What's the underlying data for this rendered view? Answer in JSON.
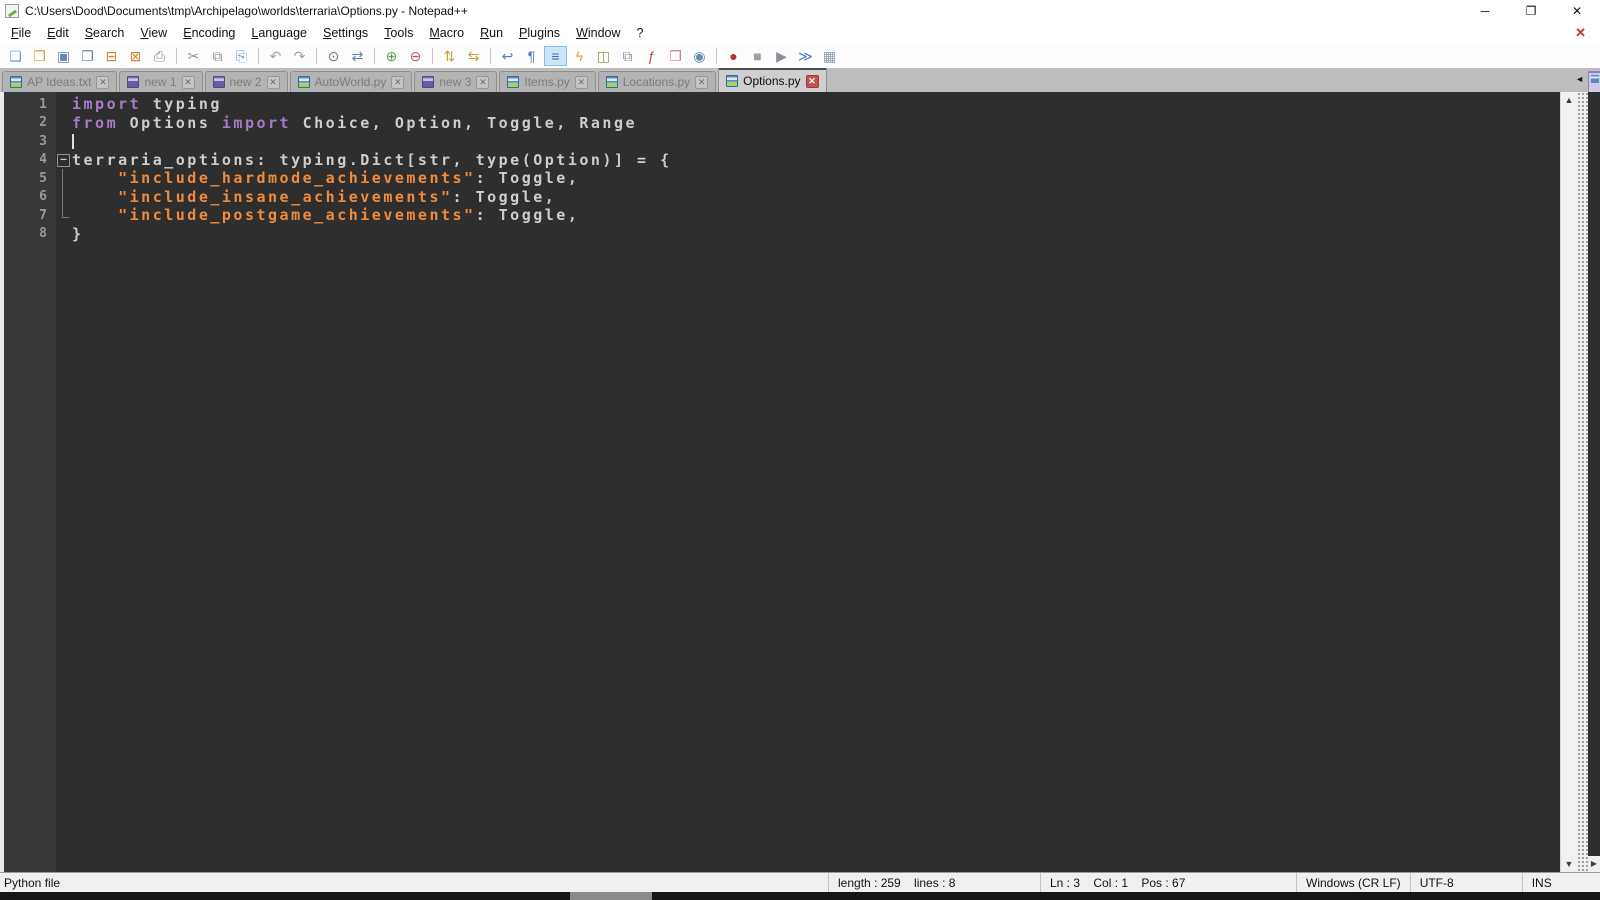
{
  "window": {
    "title": "C:\\Users\\Dood\\Documents\\tmp\\Archipelago\\worlds\\terraria\\Options.py - Notepad++",
    "minimize_glyph": "─",
    "restore_glyph": "❐",
    "close_glyph": "✕"
  },
  "menu": {
    "items": [
      "File",
      "Edit",
      "Search",
      "View",
      "Encoding",
      "Language",
      "Settings",
      "Tools",
      "Macro",
      "Run",
      "Plugins",
      "Window",
      "?"
    ],
    "close_doc_glyph": "✕"
  },
  "toolbar": {
    "icons": [
      {
        "name": "new-file-icon",
        "glyph": "❏",
        "color": "#7a9bbf"
      },
      {
        "name": "open-icon",
        "glyph": "❐",
        "color": "#d9a43b"
      },
      {
        "name": "save-icon",
        "glyph": "▣",
        "color": "#6b86b5"
      },
      {
        "name": "save-all-icon",
        "glyph": "❒",
        "color": "#6b86b5"
      },
      {
        "name": "close-doc-icon",
        "glyph": "⊟",
        "color": "#c98a3b"
      },
      {
        "name": "close-all-icon",
        "glyph": "⊠",
        "color": "#c98a3b"
      },
      {
        "name": "print-icon",
        "glyph": "⎙",
        "color": "#8a8f98"
      },
      {
        "sep": true
      },
      {
        "name": "cut-icon",
        "glyph": "✂",
        "color": "#8a8f98"
      },
      {
        "name": "copy-icon",
        "glyph": "⧉",
        "color": "#8a8f98"
      },
      {
        "name": "paste-icon",
        "glyph": "⎘",
        "color": "#7a9bbf"
      },
      {
        "sep": true
      },
      {
        "name": "undo-icon",
        "glyph": "↶",
        "color": "#9aa0a8"
      },
      {
        "name": "redo-icon",
        "glyph": "↷",
        "color": "#9aa0a8"
      },
      {
        "sep": true
      },
      {
        "name": "find-icon",
        "glyph": "⊙",
        "color": "#6e7480"
      },
      {
        "name": "replace-icon",
        "glyph": "⇄",
        "color": "#5d7fae"
      },
      {
        "sep": true
      },
      {
        "name": "zoom-in-icon",
        "glyph": "⊕",
        "color": "#5f9e5f"
      },
      {
        "name": "zoom-out-icon",
        "glyph": "⊖",
        "color": "#b05c5c"
      },
      {
        "sep": true
      },
      {
        "name": "sync-vertical-icon",
        "glyph": "⇅",
        "color": "#c9a23b"
      },
      {
        "name": "sync-horizontal-icon",
        "glyph": "⇆",
        "color": "#c9a23b"
      },
      {
        "sep": true
      },
      {
        "name": "word-wrap-icon",
        "glyph": "↩",
        "color": "#5d7fae"
      },
      {
        "name": "show-all-characters-icon",
        "glyph": "¶",
        "color": "#4f79c0"
      },
      {
        "name": "indent-guide-icon",
        "glyph": "≡",
        "color": "#3f6fb5",
        "active": true
      },
      {
        "name": "define-language-icon",
        "glyph": "ϟ",
        "color": "#d9a43b"
      },
      {
        "name": "document-map-icon",
        "glyph": "◫",
        "color": "#8ba05c"
      },
      {
        "name": "document-list-icon",
        "glyph": "⧉",
        "color": "#8a8f98"
      },
      {
        "name": "function-list-icon",
        "glyph": "ƒ",
        "color": "#b04a4a"
      },
      {
        "name": "folder-as-workspace-icon",
        "glyph": "❒",
        "color": "#c77f9e"
      },
      {
        "name": "monitoring-icon",
        "glyph": "◉",
        "color": "#5d8fae"
      },
      {
        "sep": true
      },
      {
        "name": "macro-record-icon",
        "glyph": "●",
        "color": "#b03434"
      },
      {
        "name": "macro-stop-icon",
        "glyph": "■",
        "color": "#9aa0a8"
      },
      {
        "name": "macro-play-icon",
        "glyph": "▶",
        "color": "#8a8f98"
      },
      {
        "name": "macro-run-multiple-icon",
        "glyph": "≫",
        "color": "#4f79c0"
      },
      {
        "name": "macro-save-icon",
        "glyph": "▦",
        "color": "#8a9bb0"
      }
    ]
  },
  "tabs": {
    "items": [
      {
        "label": "AP Ideas.txt",
        "icon": "saved",
        "active": false
      },
      {
        "label": "new 1",
        "icon": "new",
        "active": false
      },
      {
        "label": "new 2",
        "icon": "new",
        "active": false
      },
      {
        "label": "AutoWorld.py",
        "icon": "saved",
        "active": false
      },
      {
        "label": "new 3",
        "icon": "new",
        "active": false
      },
      {
        "label": "Items.py",
        "icon": "saved",
        "active": false
      },
      {
        "label": "Locations.py",
        "icon": "saved",
        "active": false
      },
      {
        "label": "Options.py",
        "icon": "saved",
        "active": true
      }
    ],
    "close_glyph": "✕",
    "scroll_left_glyph": "◄"
  },
  "editor": {
    "lines": [
      {
        "num": "1",
        "fold": "",
        "caret": false,
        "segments": [
          {
            "t": "import",
            "c": "kw"
          },
          {
            "t": " typing",
            "c": "def"
          }
        ]
      },
      {
        "num": "2",
        "fold": "",
        "caret": false,
        "segments": [
          {
            "t": "from",
            "c": "kw"
          },
          {
            "t": " Options ",
            "c": "def"
          },
          {
            "t": "import",
            "c": "kw"
          },
          {
            "t": " Choice, Option, Toggle, Range",
            "c": "def"
          }
        ]
      },
      {
        "num": "3",
        "fold": "",
        "caret": true,
        "segments": []
      },
      {
        "num": "4",
        "fold": "start",
        "caret": false,
        "segments": [
          {
            "t": "terraria_options: typing.Dict[str, type(Option)] = {",
            "c": "def"
          }
        ]
      },
      {
        "num": "5",
        "fold": "line",
        "caret": false,
        "segments": [
          {
            "t": "    ",
            "c": "def"
          },
          {
            "t": "\"include_hardmode_achievements\"",
            "c": "str"
          },
          {
            "t": ": Toggle,",
            "c": "def"
          }
        ]
      },
      {
        "num": "6",
        "fold": "line",
        "caret": false,
        "segments": [
          {
            "t": "    ",
            "c": "def"
          },
          {
            "t": "\"include_insane_achievements\"",
            "c": "str"
          },
          {
            "t": ": Toggle,",
            "c": "def"
          }
        ]
      },
      {
        "num": "7",
        "fold": "end",
        "caret": false,
        "segments": [
          {
            "t": "    ",
            "c": "def"
          },
          {
            "t": "\"include_postgame_achievements\"",
            "c": "str"
          },
          {
            "t": ": Toggle,",
            "c": "def"
          }
        ]
      },
      {
        "num": "8",
        "fold": "",
        "caret": false,
        "segments": [
          {
            "t": "}",
            "c": "def"
          }
        ]
      }
    ],
    "scroll_up_glyph": "▲",
    "scroll_down_glyph": "▼",
    "scroll_right_glyph": "▶"
  },
  "status": {
    "doc_type": "Python file",
    "length_lines": "length : 259    lines : 8",
    "position": "Ln : 3    Col : 1    Pos : 67",
    "eol": "Windows (CR LF)",
    "encoding": "UTF-8",
    "mode": "INS"
  },
  "colors": {
    "editor_bg": "#2e2e2e",
    "gutter_bg": "#383838",
    "keyword": "#a77bc9",
    "string": "#ef8b3a",
    "default_text": "#cdcdcd",
    "active_tab_close": "#c75050",
    "toolbar_active_bg": "#cde6f7"
  }
}
